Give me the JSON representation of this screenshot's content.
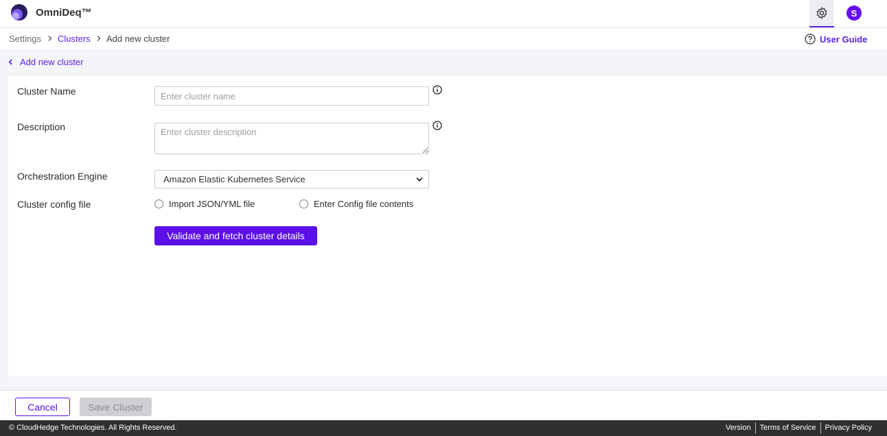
{
  "header": {
    "app_name": "OmniDeq™",
    "avatar_initial": "S",
    "brand_color": "#5b10e8"
  },
  "breadcrumb": {
    "items": [
      "Settings",
      "Clusters",
      "Add new cluster"
    ]
  },
  "user_guide_label": "User Guide",
  "back_link_label": "Add new cluster",
  "form": {
    "cluster_name": {
      "label": "Cluster Name",
      "placeholder": "Enter cluster name",
      "value": ""
    },
    "description": {
      "label": "Description",
      "placeholder": "Enter cluster description",
      "value": ""
    },
    "orchestration_engine": {
      "label": "Orchestration Engine",
      "selected": "Amazon Elastic Kubernetes Service"
    },
    "config_file": {
      "label": "Cluster config file",
      "options": [
        "Import JSON/YML file",
        "Enter Config file contents"
      ]
    },
    "validate_button": "Validate and fetch cluster details"
  },
  "actions": {
    "cancel": "Cancel",
    "save": "Save Cluster"
  },
  "footer": {
    "copyright": "© CloudHedge Technologies. All Rights Reserved.",
    "links": [
      "Version",
      "Terms of Service",
      "Privacy Policy"
    ]
  }
}
